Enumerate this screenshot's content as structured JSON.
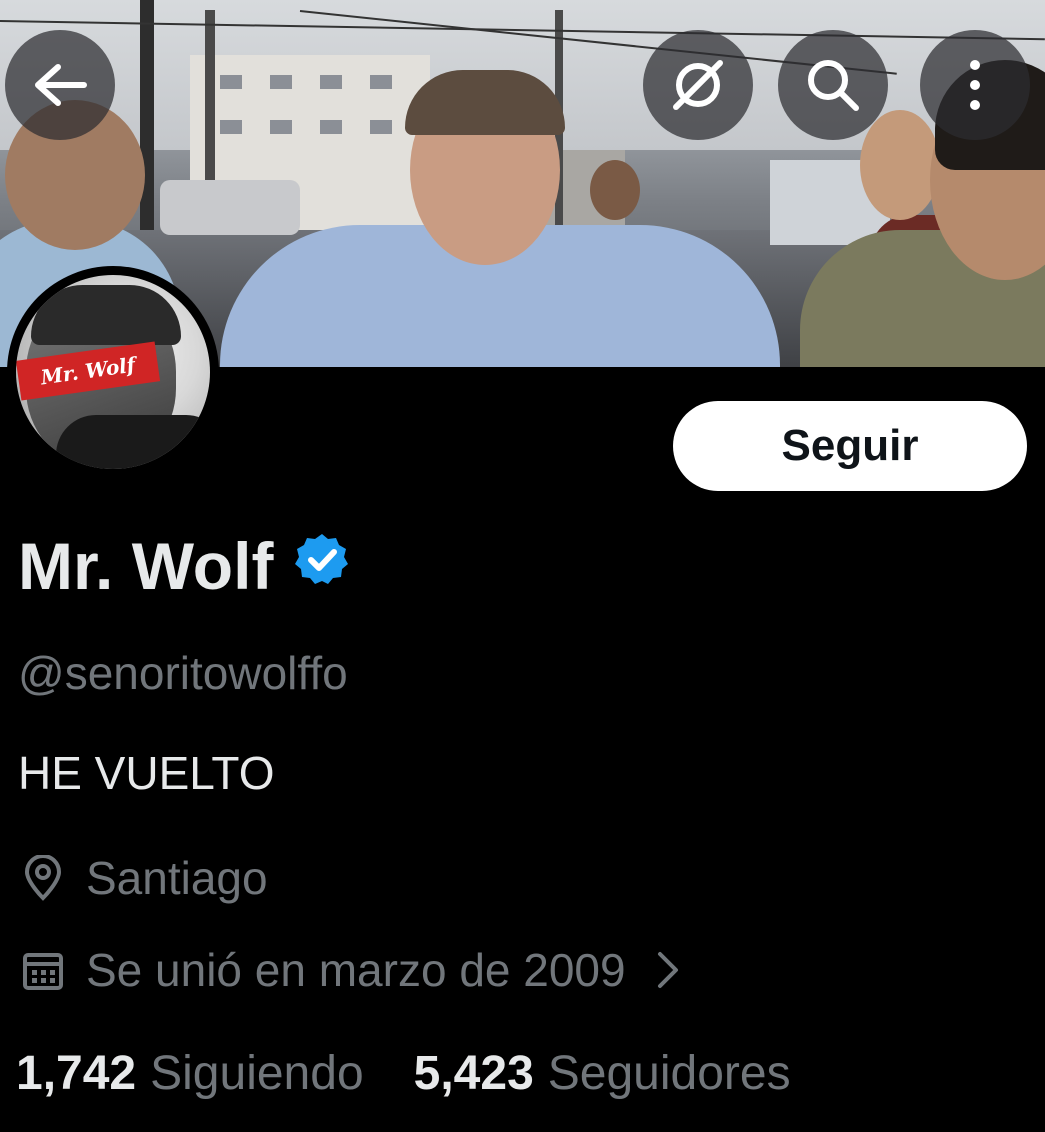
{
  "profile": {
    "display_name": "Mr. Wolf",
    "handle": "@senoritowolffo",
    "bio": "HE VUELTO",
    "location": "Santiago",
    "joined": "Se unió en marzo de 2009",
    "following_count": "1,742",
    "following_label": "Siguiendo",
    "followers_count": "5,423",
    "followers_label": "Seguidores",
    "verified": true,
    "avatar_label": "Mr. Wolf"
  },
  "actions": {
    "follow_label": "Seguir"
  },
  "icons": {
    "back": "arrow-left-icon",
    "grok": "grok-icon",
    "search": "search-icon",
    "more": "more-vertical-icon",
    "verified": "verified-badge-icon",
    "location": "location-pin-icon",
    "calendar": "calendar-icon",
    "chevron": "chevron-right-icon"
  },
  "colors": {
    "background": "#000000",
    "primary_text": "#e7e9ea",
    "secondary_text": "#71767b",
    "verified": "#1d9bf0",
    "follow_button_bg": "#ffffff"
  }
}
